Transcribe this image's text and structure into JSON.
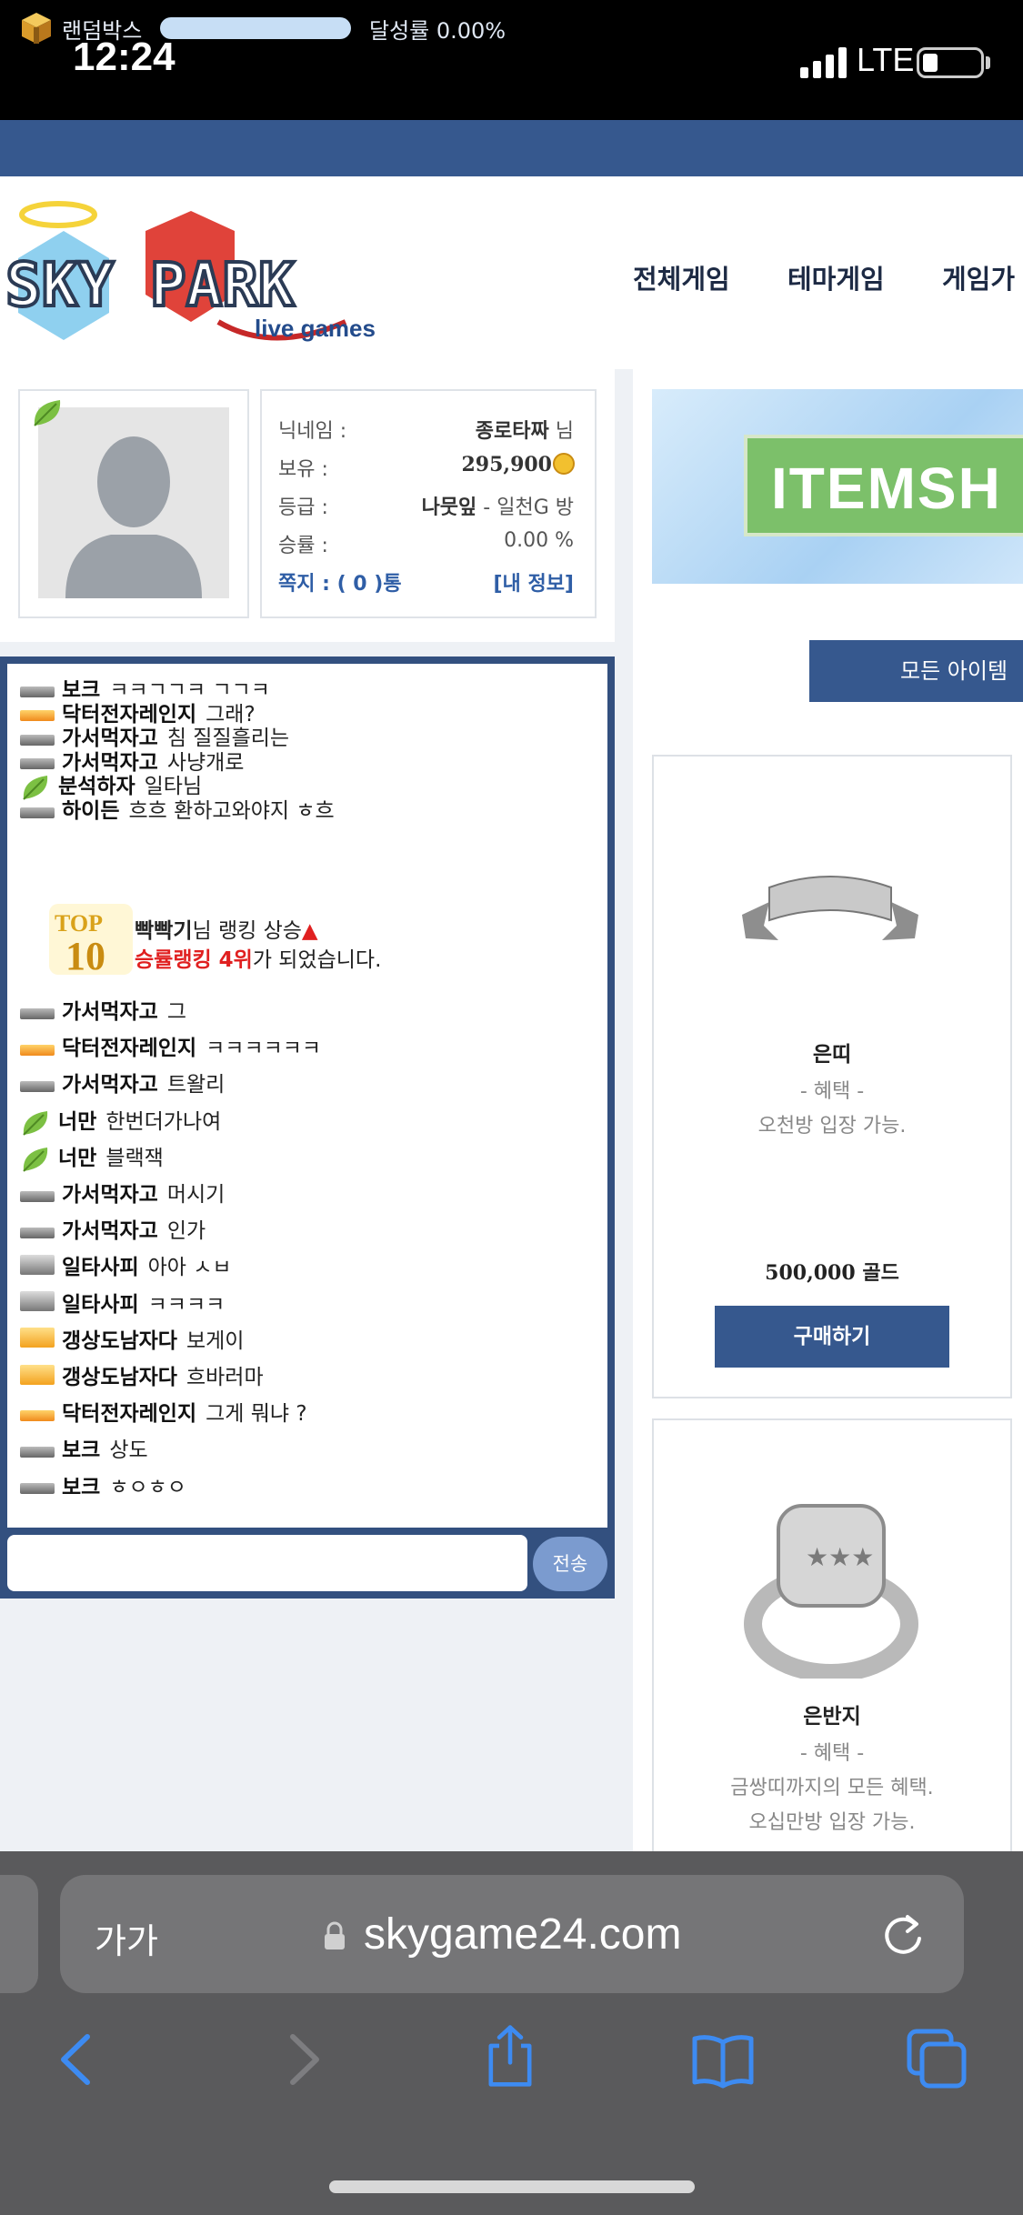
{
  "status_bar": {
    "time": "12:24",
    "network": "LTE"
  },
  "random_box": {
    "label": "랜덤박스",
    "rate_text": "달성률 0.00%",
    "progress": 0.0
  },
  "header": {
    "logo_text": "SKY PARK",
    "logo_sub": "live games",
    "nav": [
      "전체게임",
      "테마게임",
      "게임가"
    ]
  },
  "profile": {
    "nickname_label": "닉네임 :",
    "nickname_value": "종로타짜",
    "nickname_suffix": "님",
    "balance_label": "보유 :",
    "balance_value": "295,900",
    "grade_label": "등급 :",
    "grade_value": "나뭇잎",
    "grade_suffix": "- 일천G 방",
    "winrate_label": "승률 :",
    "winrate_value": "0.00 %",
    "messages": "쪽지 : ( 0 )통",
    "my_info": "[내 정보]"
  },
  "chat": {
    "lines": [
      {
        "lv": "gray",
        "nick": "보크",
        "msg": "ㅋㅋㄱㄱㅋ ㄱㄱㅋ"
      },
      {
        "lv": "orange",
        "nick": "닥터전자레인지",
        "msg": "그래?"
      },
      {
        "lv": "gray",
        "nick": "가서먹자고",
        "msg": "침 질질흘리는"
      },
      {
        "lv": "gray",
        "nick": "가서먹자고",
        "msg": "사냥개로"
      },
      {
        "lv": "leaf",
        "nick": "분석하자",
        "msg": "일타님"
      },
      {
        "lv": "gray",
        "nick": "하이든",
        "msg": "흐흐 환하고와야지 ㅎ흐"
      }
    ],
    "rank_notice": {
      "name": "빡빡기",
      "line1_suffix": "님 랭킹 상승",
      "arrow": "▲",
      "line2_red": "승률랭킹 4위",
      "line2_suffix": "가 되었습니다."
    },
    "lines2": [
      {
        "lv": "gray",
        "nick": "가서먹자고",
        "msg": "그"
      },
      {
        "lv": "orange",
        "nick": "닥터전자레인지",
        "msg": "ㅋㅋㅋㅋㅋㅋ"
      },
      {
        "lv": "gray",
        "nick": "가서먹자고",
        "msg": "트왈리"
      },
      {
        "lv": "leaf",
        "nick": "너만",
        "msg": "한번더가나여"
      },
      {
        "lv": "leaf",
        "nick": "너만",
        "msg": "블랙잭"
      },
      {
        "lv": "gray",
        "nick": "가서먹자고",
        "msg": "머시기"
      },
      {
        "lv": "gray",
        "nick": "가서먹자고",
        "msg": "인가"
      },
      {
        "lv": "gray2",
        "nick": "일타사피",
        "msg": "아아 ㅅㅂ"
      },
      {
        "lv": "gray2",
        "nick": "일타사피",
        "msg": "ㅋㅋㅋㅋ"
      },
      {
        "lv": "orange2",
        "nick": "갱상도남자다",
        "msg": "보게이"
      },
      {
        "lv": "orange2",
        "nick": "갱상도남자다",
        "msg": "흐바러마"
      },
      {
        "lv": "orange",
        "nick": "닥터전자레인지",
        "msg": "그게 뭐냐 ?"
      },
      {
        "lv": "gray",
        "nick": "보크",
        "msg": "상도"
      },
      {
        "lv": "gray",
        "nick": "보크",
        "msg": "ㅎㅇㅎㅇ"
      }
    ],
    "input_placeholder": "",
    "send_label": "전송"
  },
  "shop": {
    "banner_text": "ITEMSH",
    "all_items_label": "모든 아이템",
    "items": [
      {
        "name": "은띠",
        "benefit_title": "- 혜택 -",
        "benefit": "오천방 입장 가능.",
        "price": "500,000 골드",
        "buy_label": "구매하기"
      },
      {
        "name": "은반지",
        "benefit_title": "- 혜택 -",
        "benefit": "금쌍띠까지의 모든 혜택.",
        "benefit2": "오십만방 입장 가능."
      }
    ]
  },
  "safari": {
    "aa_label": "가가",
    "url": "skygame24.com"
  },
  "colors": {
    "primary": "#36588e",
    "chat_border": "#33507f",
    "red": "#e02020"
  }
}
